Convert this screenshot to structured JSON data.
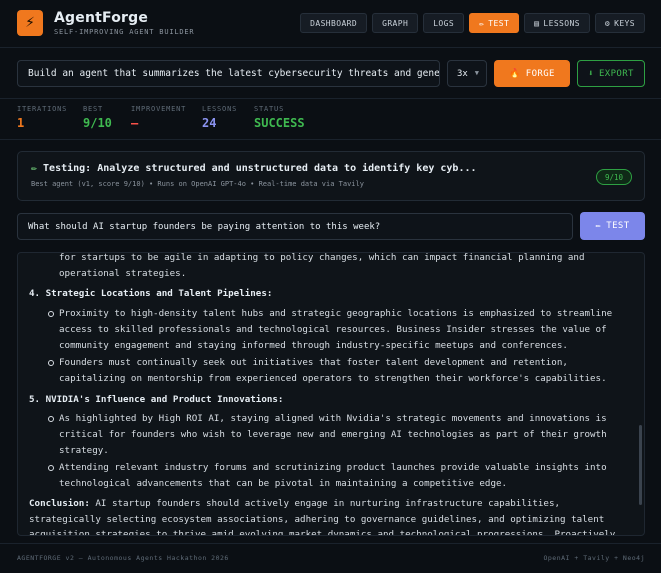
{
  "app": {
    "logo_glyph": "⚡",
    "title": "AgentForge",
    "subtitle": "SELF-IMPROVING AGENT BUILDER"
  },
  "nav": {
    "dashboard": "DASHBOARD",
    "graph": "GRAPH",
    "logs": "LOGS",
    "test": "TEST",
    "lessons": "LESSONS",
    "keys": "KEYS",
    "active": "test"
  },
  "prompt": {
    "value": "Build an agent that summarizes the latest cybersecurity threats and generates a report"
  },
  "multiplier": {
    "selected": "3x"
  },
  "actions": {
    "forge": "FORGE",
    "export": "EXPORT"
  },
  "stats": {
    "iterations": {
      "label": "ITERATIONS",
      "value": "1",
      "color": "#f0781e"
    },
    "best": {
      "label": "BEST",
      "value": "9/10",
      "color": "#3fb950"
    },
    "improvement": {
      "label": "IMPROVEMENT",
      "value": "—",
      "color": "#f85149"
    },
    "lessons": {
      "label": "LESSONS",
      "value": "24",
      "color": "#8b93f0"
    },
    "status": {
      "label": "STATUS",
      "value": "SUCCESS",
      "color": "#3fb950"
    }
  },
  "test_card": {
    "title": "Testing: Analyze structured and unstructured data to identify key cyb...",
    "subtitle": "Best agent (v1, score 9/10) • Runs on OpenAI GPT-4o • Real-time data via Tavily",
    "score": "9/10"
  },
  "question": {
    "value": "What should AI startup founders be paying attention to this week?",
    "button": "TEST"
  },
  "response": {
    "lead_paragraph": "for startups to be agile in adapting to policy changes, which can impact financial planning and operational strategies.",
    "sections": [
      {
        "heading": "4. Strategic Locations and Talent Pipelines:",
        "bullets": [
          "Proximity to high-density talent hubs and strategic geographic locations is emphasized to streamline access to skilled professionals and technological resources. Business Insider stresses the value of community engagement and staying informed through industry-specific meetups and conferences.",
          "Founders must continually seek out initiatives that foster talent development and retention, capitalizing on mentorship from experienced operators to strengthen their workforce's capabilities."
        ]
      },
      {
        "heading": "5. NVIDIA's Influence and Product Innovations:",
        "bullets": [
          "As highlighted by High ROI AI, staying aligned with Nvidia's strategic movements and innovations is critical for founders who wish to leverage new and emerging AI technologies as part of their growth strategy.",
          "Attending relevant industry forums and scrutinizing product launches provide valuable insights into technological advancements that can be pivotal in maintaining a competitive edge."
        ]
      }
    ],
    "conclusion_label": "Conclusion:",
    "conclusion_text": " AI startup founders should actively engage in nurturing infrastructure capabilities, strategically selecting ecosystem associations, adhering to governance guidelines, and optimizing talent acquisition strategies to thrive amid evolving market dynamics and technological progressions. Proactively"
  },
  "footer": {
    "left": "AGENTFORGE v2 — Autonomous Agents Hackathon 2026",
    "right": "OpenAI + Tavily + Neo4j"
  },
  "colors": {
    "accent": "#f0781e",
    "success": "#3fb950",
    "purple": "#7c86ea",
    "background": "#0b0f14"
  }
}
